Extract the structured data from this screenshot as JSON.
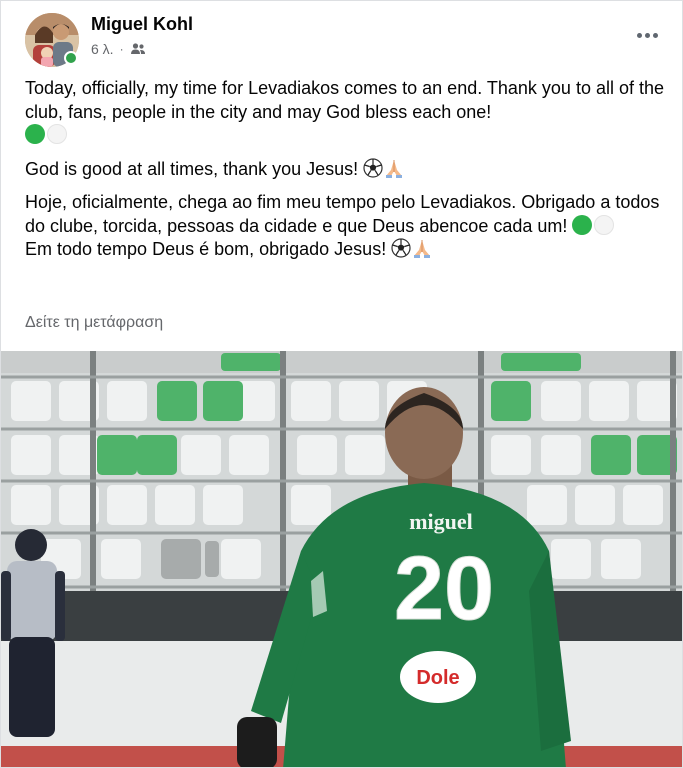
{
  "post": {
    "author": "Miguel Kohl",
    "time": "6 λ.",
    "audience_icon": "friends-icon",
    "paragraphs": {
      "p1": "Today, officially, my time for Levadiakos comes to an end.  Thank you to all of the club, fans, people in the city and may God bless each one!",
      "p2": "God is good at all times, thank you Jesus!",
      "p3": "Hoje, oficialmente, chega ao fim meu tempo pelo Levadiakos. Obrigado a todos do clube, torcida, pessoas da cidade e que Deus abencoe cada um!",
      "p4": "Em todo tempo Deus é bom, obrigado Jesus!"
    },
    "see_translation": "Δείτε τη μετάφραση"
  },
  "photo": {
    "shirt_name": "miguel",
    "shirt_number": "20",
    "sponsor": "Dole"
  },
  "colors": {
    "online": "#31a24c",
    "jersey": "#1f7a45",
    "secondary_text": "#65676b"
  }
}
